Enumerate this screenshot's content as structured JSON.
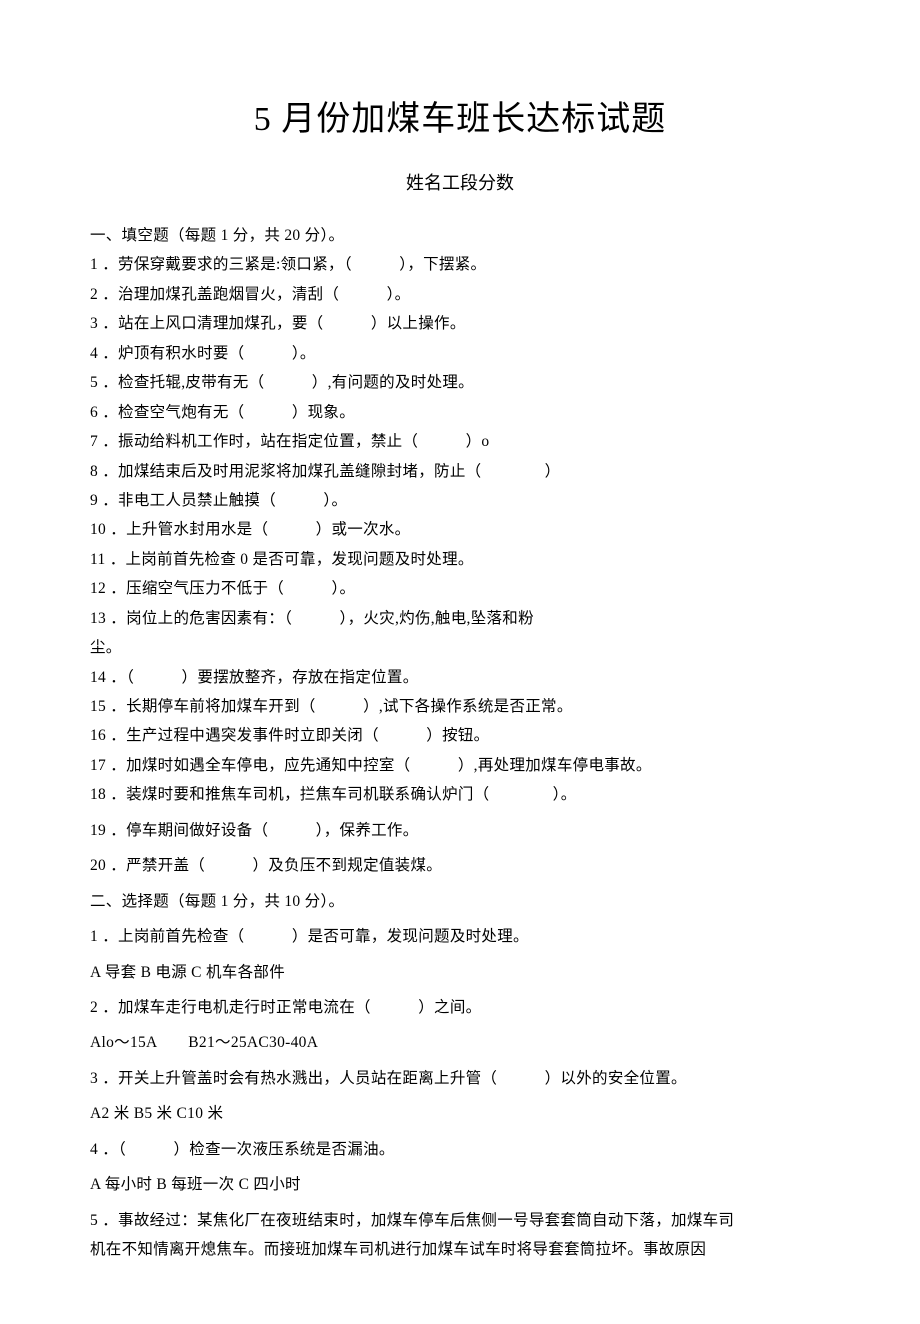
{
  "title": "5 月份加煤车班长达标试题",
  "subtitle": "姓名工段分数",
  "section1_header": "一、填空题（每题 1 分，共 20 分）。",
  "fill": {
    "q1": "1 ．劳保穿戴要求的三紧是:领口紧，（　　　），下摆紧。",
    "q2": "2 ．治理加煤孔盖跑烟冒火，清刮（　　　）。",
    "q3": "3 ．站在上风口清理加煤孔，要（　　　）以上操作。",
    "q4": "4 ．炉顶有积水时要（　　　）。",
    "q5": "5 ．检查托辊,皮带有无（　　　）,有问题的及时处理。",
    "q6": "6 ．检查空气炮有无（　　　）现象。",
    "q7": "7 ．振动给料机工作时，站在指定位置，禁止（　　　）o",
    "q8": "8 ．加煤结束后及时用泥浆将加煤孔盖缝隙封堵，防止（　　　　）",
    "q9": "9 ．非电工人员禁止触摸（　　　）。",
    "q10": "10 ．上升管水封用水是（　　　）或一次水。",
    "q11": "11 ．上岗前首先检查 0 是否可靠，发现问题及时处理。",
    "q12": "12 ．压缩空气压力不低于（　　　）。",
    "q13": "13 ．岗位上的危害因素有：（　　　），火灾,灼伤,触电,坠落和粉",
    "q13b": "尘。",
    "q14": "14 ．（　　　）要摆放整齐，存放在指定位置。",
    "q15": "15 ．长期停车前将加煤车开到（　　　）,试下各操作系统是否正常。",
    "q16": "16 ．生产过程中遇突发事件时立即关闭（　　　）按钮。",
    "q17": "17 ．加煤时如遇全车停电，应先通知中控室（　　　）,再处理加煤车停电事故。",
    "q18": "18 ．装煤时要和推焦车司机，拦焦车司机联系确认炉门（　　　　）。",
    "q19": "19 ．停车期间做好设备（　　　），保养工作。",
    "q20": "20 ．严禁开盖（　　　）及负压不到规定值装煤。"
  },
  "section2_header": "二、选择题（每题 1 分，共 10 分）。",
  "choice": {
    "q1": "1 ．上岗前首先检查（　　　）是否可靠，发现问题及时处理。",
    "q1_opts": "A 导套 B 电源 C 机车各部件",
    "q2": "2 ．加煤车走行电机走行时正常电流在（　　　）之间。",
    "q2_opts": "Alo〜15A　　B21〜25AC30-40A",
    "q3": "3 ．开关上升管盖时会有热水溅出，人员站在距离上升管（　　　）以外的安全位置。",
    "q3_opts": "A2 米 B5 米 C10 米",
    "q4": "4 ．（　　　）检查一次液压系统是否漏油。",
    "q4_opts": "A 每小时 B 每班一次 C 四小时",
    "q5a": "5 ．事故经过：某焦化厂在夜班结束时，加煤车停车后焦侧一号导套套筒自动下落，加煤车司",
    "q5b": "机在不知情离开熄焦车。而接班加煤车司机进行加煤车试车时将导套套筒拉坏。事故原因"
  }
}
